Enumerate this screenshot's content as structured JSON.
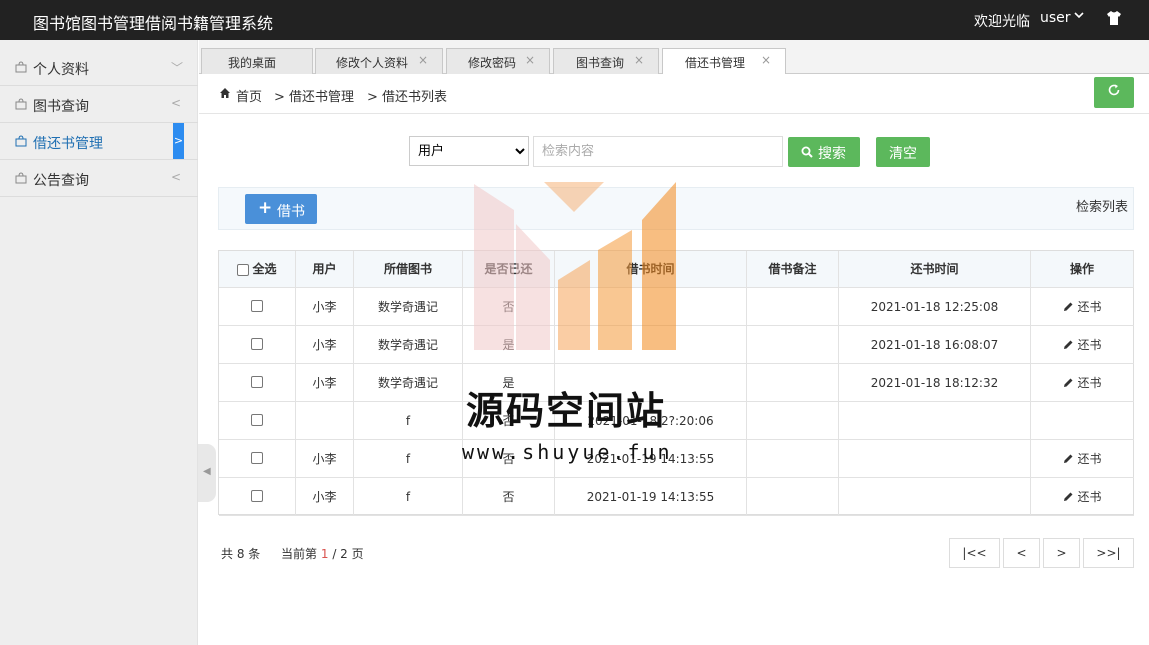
{
  "header": {
    "title": "图书馆图书管理借阅书籍管理系统",
    "welcome": "欢迎光临",
    "user": "user"
  },
  "sidebar": {
    "items": [
      {
        "label": "个人资料",
        "arrow": "﹀"
      },
      {
        "label": "图书查询",
        "arrow": "<"
      },
      {
        "label": "借还书管理",
        "arrow": ">"
      },
      {
        "label": "公告查询",
        "arrow": "<"
      }
    ]
  },
  "tabs": [
    {
      "label": "我的桌面"
    },
    {
      "label": "修改个人资料",
      "close": "×"
    },
    {
      "label": "修改密码",
      "close": "×"
    },
    {
      "label": "图书查询",
      "close": "×"
    },
    {
      "label": "借还书管理",
      "close": "×"
    }
  ],
  "breadcrumb": {
    "home": "首页",
    "level1": "> 借还书管理",
    "level2": "> 借还书列表"
  },
  "search": {
    "selected": "用户",
    "options": [
      "用户"
    ],
    "placeholder": "检索内容",
    "search_label": "搜索",
    "clear_label": "清空"
  },
  "toolbar": {
    "borrow_label": "借书",
    "list_title": "检索列表"
  },
  "table": {
    "headers": [
      "全选",
      "用户",
      "所借图书",
      "是否已还",
      "借书时间",
      "借书备注",
      "还书时间",
      "操作"
    ],
    "rows": [
      {
        "user": "小李",
        "book": "数学奇遇记",
        "returned": "否",
        "borrow_time": "",
        "remark": "",
        "return_time": "2021-01-18 12:25:08",
        "op": "还书"
      },
      {
        "user": "小李",
        "book": "数学奇遇记",
        "returned": "是",
        "borrow_time": "",
        "remark": "",
        "return_time": "2021-01-18 16:08:07",
        "op": "还书"
      },
      {
        "user": "小李",
        "book": "数学奇遇记",
        "returned": "是",
        "borrow_time": "",
        "remark": "",
        "return_time": "2021-01-18 18:12:32",
        "op": "还书"
      },
      {
        "user": "",
        "book": "f",
        "returned": "否",
        "borrow_time": "2021-01-18 2?:20:06",
        "remark": "",
        "return_time": "",
        "op": ""
      },
      {
        "user": "小李",
        "book": "f",
        "returned": "否",
        "borrow_time": "2021-01-19 14:13:55",
        "remark": "",
        "return_time": "",
        "op": "还书"
      },
      {
        "user": "小李",
        "book": "f",
        "returned": "否",
        "borrow_time": "2021-01-19 14:13:55",
        "remark": "",
        "return_time": "",
        "op": "还书"
      }
    ]
  },
  "pager": {
    "total": "共 8 条",
    "current_prefix": "当前第",
    "current": "1",
    "current_suffix": "/ 2 页",
    "first": "|<<",
    "prev": "<",
    "next": ">",
    "last": ">>|"
  },
  "watermark": {
    "name": "源码空间站",
    "url": "www.shuyue.fun"
  },
  "colors": {
    "topbar": "#222222",
    "green": "#5cb85c",
    "blue": "#4a90d9",
    "active_marker": "#2d8cf0"
  }
}
